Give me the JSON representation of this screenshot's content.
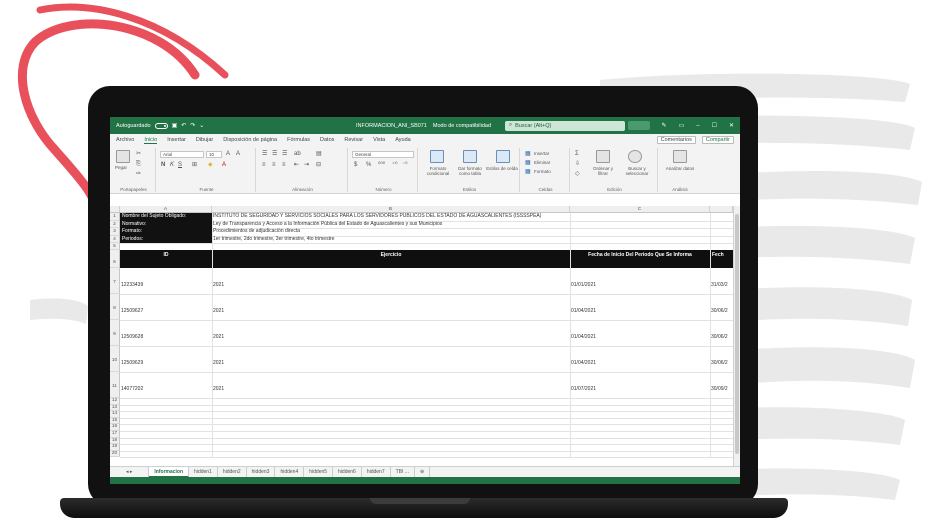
{
  "titlebar": {
    "autosave": "Autoguardado",
    "filename": "INFORMACION_ANI_SB071",
    "mode": "Modo de compatibilidad",
    "search": "Buscar (Alt+Q)"
  },
  "menu": {
    "tabs": [
      "Archivo",
      "Inicio",
      "Insertar",
      "Dibujar",
      "Disposición de página",
      "Fórmulas",
      "Datos",
      "Revisar",
      "Vista",
      "Ayuda"
    ],
    "active_index": 1,
    "comments": "Comentarios",
    "share": "Compartir"
  },
  "ribbon": {
    "groups": [
      "Portapapeles",
      "Fuente",
      "Alineación",
      "Número",
      "Estilos",
      "Celdas",
      "Edición",
      "Análisis"
    ],
    "paste": "Pegar",
    "font_name": "Arial",
    "font_size": "10",
    "number_format": "General",
    "cond_format": "Formato condicional",
    "table_format": "Dar formato como tabla",
    "cell_styles": "Estilos de celda",
    "insert": "Insertar",
    "delete": "Eliminar",
    "format": "Formato",
    "sort_filter": "Ordenar y filtrar",
    "find_select": "Buscar y seleccionar",
    "analyze": "Analizar datos"
  },
  "grid": {
    "columns": [
      "A",
      "B",
      "C"
    ],
    "meta": [
      {
        "row": "1",
        "label": "Nombre del Sujeto Obligado:",
        "value": "INSTITUTO DE SEGURIDAD Y SERVICIOS SOCIALES PARA LOS  SERVIDORES PÚBLICOS DEL ESTADO DE AGUASCALIENTES (ISSSSPEA)"
      },
      {
        "row": "2",
        "label": "Normativo:",
        "value": "Ley de Transparencia y Acceso a la Información Pública del Estado de Aguascalientes y sus Municipios"
      },
      {
        "row": "3",
        "label": "Formato:",
        "value": "Procedimientos de adjudicación directa"
      },
      {
        "row": "4",
        "label": "Periodos:",
        "value": "1er trimestre, 2do trimestre, 3er trimestre, 4to trimestre"
      }
    ],
    "header_row": "6",
    "headers": {
      "id": "ID",
      "ejercicio": "Ejercicio",
      "fecha_inicio": "Fecha de Inicio Del Periodo Que Se Informa",
      "fecha_fin": "Fech"
    },
    "rows": [
      {
        "row": "7",
        "id": "12233439",
        "ejercicio": "2021",
        "fecha_inicio": "01/01/2021",
        "fecha_fin": "31/03/2"
      },
      {
        "row": "8",
        "id": "12509627",
        "ejercicio": "2021",
        "fecha_inicio": "01/04/2021",
        "fecha_fin": "30/06/2"
      },
      {
        "row": "9",
        "id": "12509628",
        "ejercicio": "2021",
        "fecha_inicio": "01/04/2021",
        "fecha_fin": "30/06/2"
      },
      {
        "row": "10",
        "id": "12509629",
        "ejercicio": "2021",
        "fecha_inicio": "01/04/2021",
        "fecha_fin": "30/06/2"
      },
      {
        "row": "11",
        "id": "14077202",
        "ejercicio": "2021",
        "fecha_inicio": "01/07/2021",
        "fecha_fin": "30/09/2"
      }
    ],
    "empty_rows": [
      "12",
      "13",
      "14",
      "15",
      "16",
      "17",
      "18",
      "19",
      "20"
    ]
  },
  "sheets": {
    "tabs": [
      "Informacion",
      "hidden1",
      "hidden2",
      "hidden3",
      "hidden4",
      "hidden5",
      "hidden6",
      "hidden7",
      "TBI ..."
    ],
    "active_index": 0
  },
  "colors": {
    "excel_green": "#217346",
    "header_black": "#0f0f0f",
    "swoosh_red": "#e8505b",
    "brush_gray": "#e6e6e6"
  }
}
